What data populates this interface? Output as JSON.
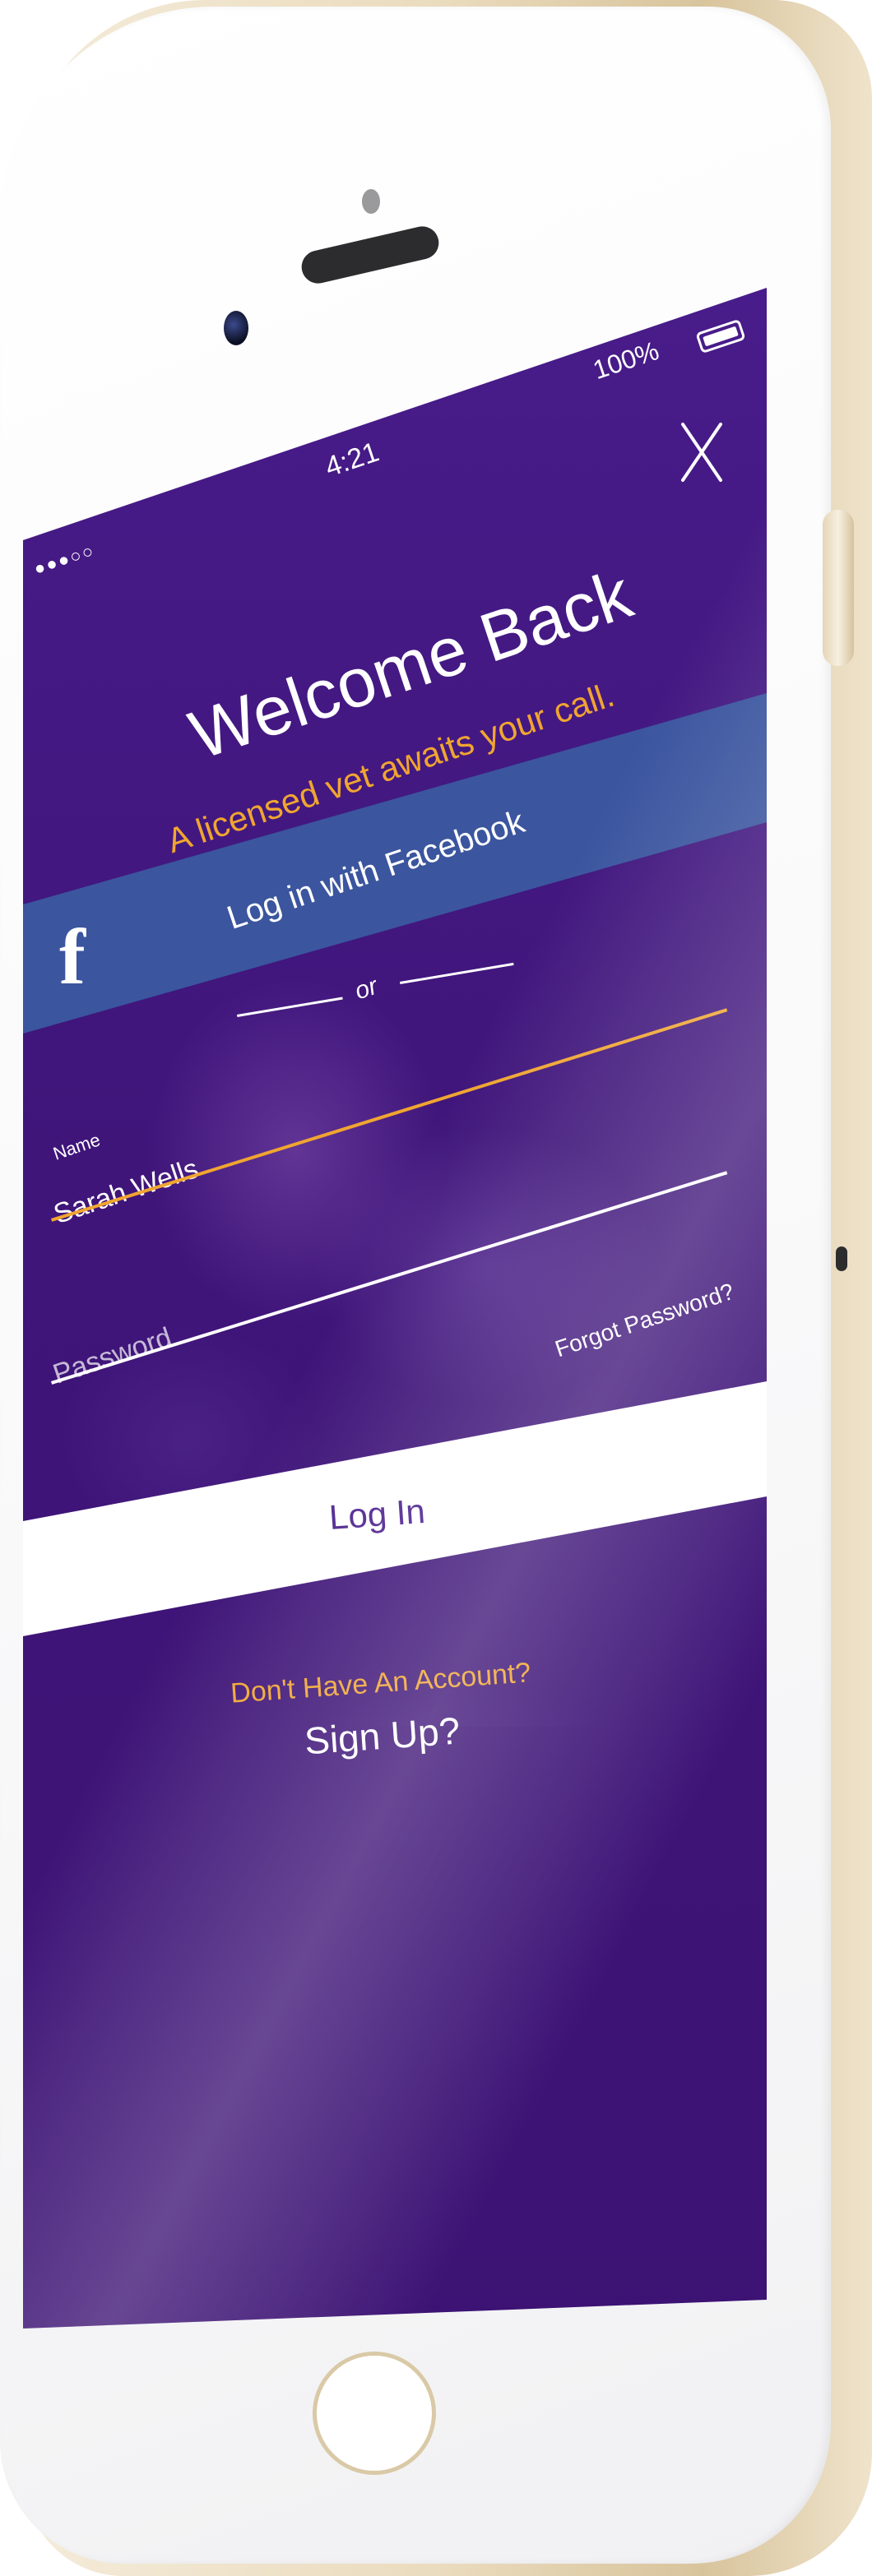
{
  "status_bar": {
    "time": "4:21",
    "battery": "100%",
    "signal_dots": "●●●○○"
  },
  "header": {
    "title": "Welcome Back",
    "subtitle": "A licensed vet awaits your call."
  },
  "facebook": {
    "logo": "f",
    "label": "Log in with Facebook"
  },
  "divider": {
    "text": "or"
  },
  "form": {
    "name_label": "Name",
    "name_value": "Sarah Wells",
    "password_placeholder": "Password",
    "forgot_label": "Forgot Password?"
  },
  "login": {
    "label": "Log In"
  },
  "footer": {
    "account_prompt": "Don't Have An Account?",
    "signup_label": "Sign Up?"
  },
  "colors": {
    "background": "#3f157a",
    "accent": "#f0a531",
    "facebook": "#3b59a0",
    "login_text": "#4a1f8c"
  },
  "icons": {
    "close": "close-icon",
    "battery": "battery-icon",
    "facebook": "facebook-icon"
  }
}
